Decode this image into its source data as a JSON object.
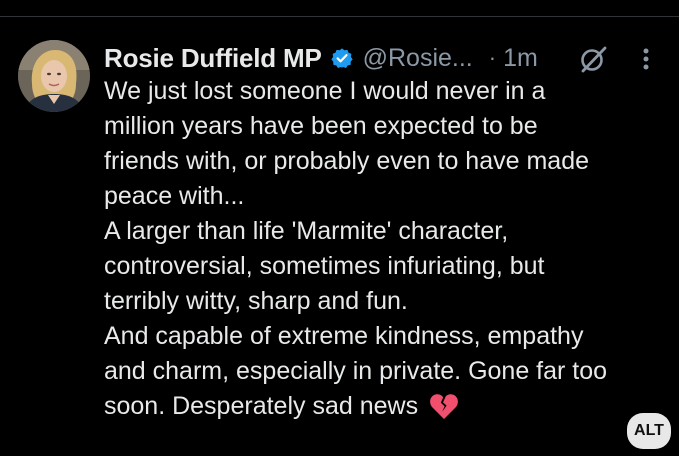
{
  "tweet": {
    "display_name": "Rosie Duffield MP",
    "handle": "@Rosie...",
    "separator": "·",
    "time": "1m",
    "text": "We just lost someone I would never in a\nmillion years have been expected to be\nfriends with, or probably even to have made\npeace with...\nA larger than life 'Marmite' character,\ncontroversial, sometimes infuriating, but\nterribly witty, sharp and fun.\nAnd capable of extreme kindness, empathy\nand charm, especially in private. Gone far too\nsoon. Desperately sad news",
    "emoji": "💔"
  },
  "icons": {
    "verified": "verified-badge-icon",
    "grok": "grok-icon",
    "more": "more-vertical-icon",
    "broken_heart": "broken-heart-icon"
  },
  "alt_badge": "ALT",
  "colors": {
    "background": "#000000",
    "text": "#e7e9ea",
    "secondary": "#8b98a5",
    "verified": "#1d9bf0",
    "broken_heart": "#f0506e"
  }
}
